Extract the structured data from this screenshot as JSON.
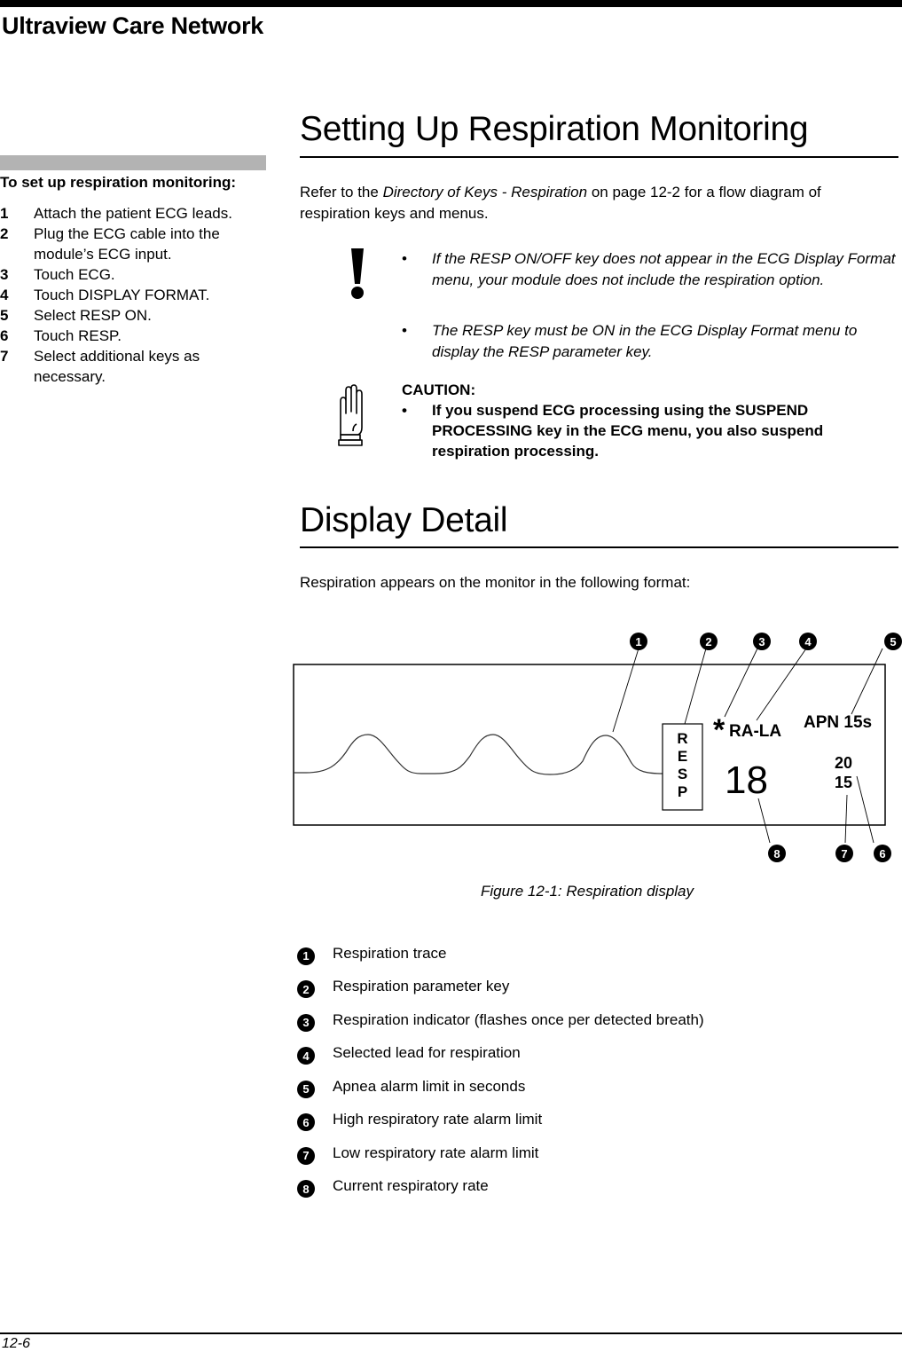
{
  "header": {
    "title": "Ultraview Care Network"
  },
  "sidebar": {
    "heading": "To set up respiration monitoring:",
    "steps": [
      {
        "num": "1",
        "text": "Attach the patient ECG leads."
      },
      {
        "num": "2",
        "text": "Plug the ECG cable into the module’s ECG input."
      },
      {
        "num": "3",
        "text": "Touch ECG."
      },
      {
        "num": "4",
        "text": "Touch DISPLAY FORMAT."
      },
      {
        "num": "5",
        "text": "Select RESP ON."
      },
      {
        "num": "6",
        "text": "Touch RESP."
      },
      {
        "num": "7",
        "text": "Select additional keys as necessary."
      }
    ]
  },
  "section1": {
    "title": "Setting Up Respiration Monitoring",
    "intro_pre": "Refer to the ",
    "intro_link": "Directory of Keys - Respiration",
    "intro_post": " on page 12-2 for a flow diagram of respiration keys and menus.",
    "note_icon": "exclamation-icon",
    "notes": [
      "If the RESP ON/OFF key does not appear in the ECG Display Format menu, your module does not include the respiration option.",
      "The RESP key must be ON in the ECG Display Format menu to display the RESP parameter key."
    ],
    "bullet": "•",
    "caution_icon": "hand-stop-icon",
    "caution_label": "CAUTION:",
    "cautions": [
      "If you suspend ECG processing using the SUSPEND PROCESSING key in the ECG menu, you also suspend respiration processing."
    ]
  },
  "section2": {
    "title": "Display Detail",
    "intro": "Respiration appears on the monitor in the following format:",
    "figure": {
      "param_key": [
        "R",
        "E",
        "S",
        "P"
      ],
      "indicator": "*",
      "lead": "RA-LA",
      "apnea": "APN 15s",
      "rate": "18",
      "high_limit": "20",
      "low_limit": "15",
      "callouts": [
        "1",
        "2",
        "3",
        "4",
        "5",
        "6",
        "7",
        "8"
      ]
    },
    "caption": "Figure 12-1: Respiration display",
    "legend": [
      {
        "num": "1",
        "text": "Respiration trace"
      },
      {
        "num": "2",
        "text": "Respiration parameter key"
      },
      {
        "num": "3",
        "text": "Respiration indicator (flashes once per detected breath)"
      },
      {
        "num": "4",
        "text": "Selected lead for respiration"
      },
      {
        "num": "5",
        "text": "Apnea alarm limit in seconds"
      },
      {
        "num": "6",
        "text": "High respiratory rate alarm limit"
      },
      {
        "num": "7",
        "text": "Low respiratory rate alarm limit"
      },
      {
        "num": "8",
        "text": "Current respiratory rate"
      }
    ]
  },
  "footer": {
    "page": "12-6"
  }
}
